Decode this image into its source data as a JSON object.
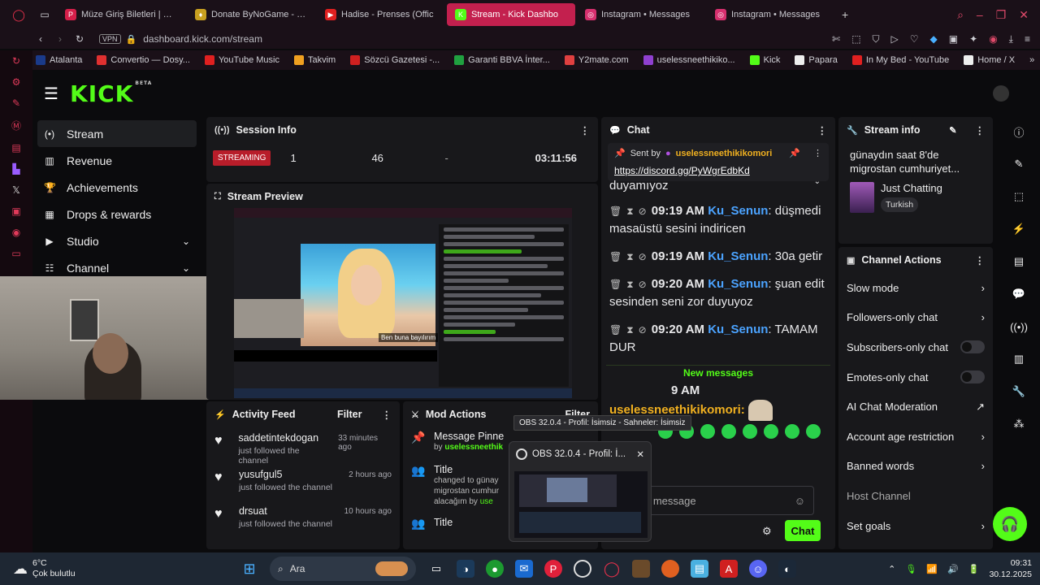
{
  "tabs": [
    {
      "label": "Müze Giriş Biletleri | Passo",
      "color": "#d61f4a",
      "glyph": "P"
    },
    {
      "label": "Donate ByNoGame - usele",
      "color": "#c8a020",
      "glyph": "♦"
    },
    {
      "label": "Hadise - Prenses (Offic",
      "color": "#e02020",
      "glyph": "▶"
    },
    {
      "label": "Stream - Kick Dashbo",
      "color": "#53fc18",
      "glyph": "K"
    },
    {
      "label": "Instagram • Messages",
      "color": "#d6306e",
      "glyph": "◎"
    },
    {
      "label": "Instagram • Messages",
      "color": "#d6306e",
      "glyph": "◎"
    }
  ],
  "nav": {
    "vpn": "VPN",
    "url": "dashboard.kick.com/stream"
  },
  "bookmarks": [
    {
      "label": "Atalanta",
      "color": "#1a3a8a"
    },
    {
      "label": "Convertio — Dosy...",
      "color": "#e03030"
    },
    {
      "label": "YouTube Music",
      "color": "#e02020"
    },
    {
      "label": "Takvim",
      "color": "#f0a020"
    },
    {
      "label": "Sözcü Gazetesi -...",
      "color": "#d02020"
    },
    {
      "label": "Garanti BBVA İnter...",
      "color": "#20a040"
    },
    {
      "label": "Y2mate.com",
      "color": "#e04040"
    },
    {
      "label": "uselessneethikiko...",
      "color": "#9040d0"
    },
    {
      "label": "Kick",
      "color": "#53fc18"
    },
    {
      "label": "Papara",
      "color": "#eeeeee"
    },
    {
      "label": "In My Bed - YouTube",
      "color": "#e02020"
    },
    {
      "label": "Home / X",
      "color": "#eeeeee"
    }
  ],
  "brand": {
    "logo": "KICK",
    "beta": "BETA"
  },
  "leftnav": [
    {
      "label": "Stream",
      "icon": "(•)",
      "active": true
    },
    {
      "label": "Revenue",
      "icon": "▥"
    },
    {
      "label": "Achievements",
      "icon": "🏆"
    },
    {
      "label": "Drops & rewards",
      "icon": "▦"
    },
    {
      "label": "Studio",
      "icon": "▶",
      "chevron": true
    },
    {
      "label": "Channel",
      "icon": "☷",
      "chevron": true
    }
  ],
  "session": {
    "title": "Session Info",
    "status": "STREAMING",
    "viewers": "1",
    "followers": "46",
    "dash": "-",
    "uptime": "03:11:56"
  },
  "preview": {
    "title": "Stream Preview",
    "subtitle_text": "Ben buna bayılırım"
  },
  "activity": {
    "title": "Activity Feed",
    "filter": "Filter",
    "items": [
      {
        "name": "saddetintekdogan",
        "time": "33 minutes ago",
        "action": "just followed the channel"
      },
      {
        "name": "yusufgul5",
        "time": "2 hours ago",
        "action": "just followed the channel"
      },
      {
        "name": "drsuat",
        "time": "10 hours ago",
        "action": "just followed the channel"
      }
    ]
  },
  "mod": {
    "title": "Mod Actions",
    "filter": "Filter",
    "items": [
      {
        "title": "Message Pinne",
        "by_prefix": "by ",
        "by_user": "uselessneethik"
      },
      {
        "title": "Title",
        "l1": "changed to günay",
        "l2": "migrostan cumhur",
        "l3_prefix": "alacağım by ",
        "l3_user": "use"
      },
      {
        "title": "Title"
      }
    ]
  },
  "chat": {
    "title": "Chat",
    "pinned_prefix": "Sent by",
    "pinned_user": "uselessneethikikomori",
    "pinned_link": "https://discord.gg/PyWgrEdbKd",
    "cut_text": "duyamıyoz",
    "messages": [
      {
        "time": "09:19 AM",
        "user": "Ku_Senun",
        "text": "düşmedi masaüstü sesini indiricen"
      },
      {
        "time": "09:19 AM",
        "user": "Ku_Senun",
        "text": "30a getir"
      },
      {
        "time": "09:20 AM",
        "user": "Ku_Senun",
        "text": "şuan edit sesinden seni zor duyuyoz"
      },
      {
        "time": "09:20 AM",
        "user": "Ku_Senun",
        "text": "TAMAM DUR"
      }
    ],
    "new_messages": "New messages",
    "last_time": "9 AM",
    "last_user": "uselessneethikikomori:",
    "input_placeholder": "Send a message",
    "send": "Chat"
  },
  "streaminfo": {
    "title": "Stream info",
    "stream_title": "günaydın saat 8'de migrostan cumhuriyet...",
    "category": "Just Chatting",
    "tag": "Turkish"
  },
  "channel_actions": {
    "title": "Channel Actions",
    "items": [
      {
        "label": "Slow mode",
        "kind": "chevron"
      },
      {
        "label": "Followers-only chat",
        "kind": "chevron"
      },
      {
        "label": "Subscribers-only chat",
        "kind": "toggle"
      },
      {
        "label": "Emotes-only chat",
        "kind": "toggle"
      },
      {
        "label": "AI Chat Moderation",
        "kind": "external"
      },
      {
        "label": "Account age restriction",
        "kind": "chevron"
      },
      {
        "label": "Banned words",
        "kind": "chevron"
      },
      {
        "label": "Host Channel",
        "kind": "none"
      },
      {
        "label": "Set goals",
        "kind": "chevron"
      }
    ]
  },
  "obs": {
    "tooltip": "OBS 32.0.4 - Profil: İsimsiz - Sahneler: İsimsiz",
    "card_title": "OBS 32.0.4 - Profil: İ..."
  },
  "taskbar": {
    "temp": "6°C",
    "weather": "Çok bulutlu",
    "search": "Ara",
    "time": "09:31",
    "date": "30.12.2025"
  }
}
